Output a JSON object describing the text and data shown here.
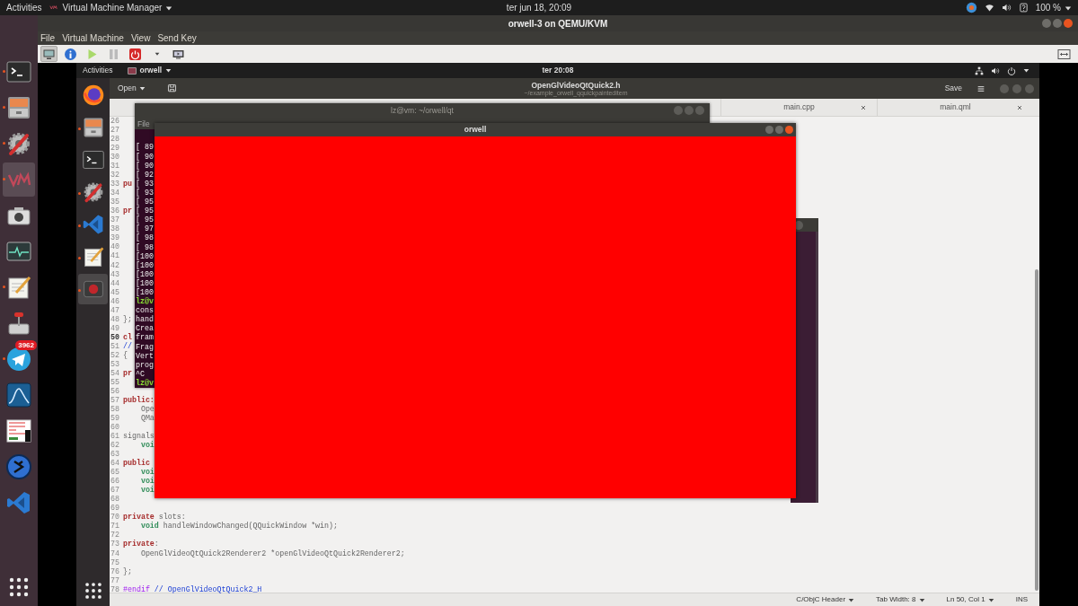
{
  "top_bar": {
    "activities": "Activities",
    "app_menu": "Virtual Machine Manager",
    "clock": "ter jun 18, 20:09",
    "battery": "100 %"
  },
  "dock": {
    "items": [
      {
        "kind": "terminal",
        "running": true,
        "selected": false
      },
      {
        "kind": "files",
        "running": true,
        "selected": false
      },
      {
        "kind": "settings",
        "running": true,
        "selected": false
      },
      {
        "kind": "vm",
        "running": true,
        "selected": true
      },
      {
        "kind": "camera",
        "running": false,
        "selected": false
      },
      {
        "kind": "monitor",
        "running": false,
        "selected": false
      },
      {
        "kind": "notepad",
        "running": true,
        "selected": false
      },
      {
        "kind": "installer",
        "running": false,
        "selected": false
      },
      {
        "kind": "telegram",
        "running": true,
        "selected": false,
        "badge": "3962"
      },
      {
        "kind": "wireshark",
        "running": false,
        "selected": false
      },
      {
        "kind": "bitmap",
        "running": false,
        "selected": false
      },
      {
        "kind": "emblem",
        "running": false,
        "selected": false
      },
      {
        "kind": "vscode",
        "running": false,
        "selected": false
      }
    ]
  },
  "vm_window": {
    "title": "orwell-3 on QEMU/KVM",
    "menu": [
      "File",
      "Virtual Machine",
      "View",
      "Send Key"
    ],
    "toolbar": [
      {
        "kind": "console",
        "pressed": true
      },
      {
        "kind": "info",
        "pressed": false
      },
      {
        "kind": "play",
        "pressed": false
      },
      {
        "kind": "pause",
        "pressed": false
      },
      {
        "kind": "power",
        "pressed": false
      },
      {
        "kind": "caret",
        "pressed": false
      },
      {
        "kind": "screen",
        "pressed": false
      }
    ]
  },
  "guest": {
    "top_bar": {
      "activities": "Activities",
      "app_menu": "orwell",
      "clock": "ter 20:08"
    },
    "dock": {
      "items": [
        {
          "kind": "firefox",
          "running": false,
          "selected": false
        },
        {
          "kind": "files",
          "running": true,
          "selected": false
        },
        {
          "kind": "terminal",
          "running": false,
          "selected": false
        },
        {
          "kind": "settings",
          "running": true,
          "selected": false
        },
        {
          "kind": "vscode",
          "running": true,
          "selected": false
        },
        {
          "kind": "notepad",
          "running": true,
          "selected": false
        },
        {
          "kind": "record",
          "running": true,
          "selected": true
        }
      ]
    },
    "editor": {
      "open_button": "Open",
      "title": "OpenGlVideoQtQuick2.h",
      "subtitle": "~/example_orwell_qquickpainteditem",
      "save_button": "Save",
      "tabs": [
        {
          "label": "main.cpp",
          "selected": false
        },
        {
          "label": "main.qml",
          "selected": false
        }
      ],
      "lines": [
        {
          "number": "26",
          "current": false
        },
        {
          "number": "27",
          "current": false
        },
        {
          "number": "28",
          "current": false
        },
        {
          "number": "29",
          "current": false
        },
        {
          "number": "30",
          "current": false
        },
        {
          "number": "31",
          "current": false
        },
        {
          "number": "32",
          "current": false
        },
        {
          "number": "33",
          "current": false,
          "tokens": [
            {
              "text": "pu",
              "kind": "keyword"
            }
          ]
        },
        {
          "number": "34",
          "current": false
        },
        {
          "number": "35",
          "current": false
        },
        {
          "number": "36",
          "current": false,
          "tokens": [
            {
              "text": "pr",
              "kind": "keyword"
            }
          ]
        },
        {
          "number": "37",
          "current": false
        },
        {
          "number": "38",
          "current": false
        },
        {
          "number": "39",
          "current": false
        },
        {
          "number": "40",
          "current": false
        },
        {
          "number": "41",
          "current": false
        },
        {
          "number": "42",
          "current": false
        },
        {
          "number": "43",
          "current": false
        },
        {
          "number": "44",
          "current": false
        },
        {
          "number": "45",
          "current": false
        },
        {
          "number": "46",
          "current": false
        },
        {
          "number": "47",
          "current": false
        },
        {
          "number": "48",
          "current": false,
          "tokens": [
            {
              "text": "};",
              "kind": "plain"
            }
          ]
        },
        {
          "number": "49",
          "current": false
        },
        {
          "number": "50",
          "current": true,
          "tokens": [
            {
              "text": "cl",
              "kind": "keyword"
            }
          ]
        },
        {
          "number": "51",
          "current": false,
          "tokens": [
            {
              "text": "//",
              "kind": "comment"
            }
          ]
        },
        {
          "number": "52",
          "current": false,
          "tokens": [
            {
              "text": "{",
              "kind": "plain"
            }
          ]
        },
        {
          "number": "53",
          "current": false
        },
        {
          "number": "54",
          "current": false,
          "tokens": [
            {
              "text": "pr",
              "kind": "keyword"
            }
          ]
        },
        {
          "number": "55",
          "current": false
        },
        {
          "number": "56",
          "current": false
        },
        {
          "number": "57",
          "current": false,
          "tokens": [
            {
              "text": "public:",
              "kind": "keyword"
            }
          ]
        },
        {
          "number": "58",
          "current": false,
          "tokens": [
            {
              "text": "    Ope",
              "kind": "plain"
            }
          ]
        },
        {
          "number": "59",
          "current": false,
          "tokens": [
            {
              "text": "    QMa",
              "kind": "plain"
            }
          ]
        },
        {
          "number": "60",
          "current": false
        },
        {
          "number": "61",
          "current": false,
          "tokens": [
            {
              "text": "signals",
              "kind": "plain"
            }
          ]
        },
        {
          "number": "62",
          "current": false,
          "tokens": [
            {
              "text": "    voi",
              "kind": "type"
            }
          ]
        },
        {
          "number": "63",
          "current": false
        },
        {
          "number": "64",
          "current": false,
          "tokens": [
            {
              "text": "public",
              "kind": "keyword"
            }
          ]
        },
        {
          "number": "65",
          "current": false,
          "tokens": [
            {
              "text": "    voi",
              "kind": "type"
            }
          ]
        },
        {
          "number": "66",
          "current": false,
          "tokens": [
            {
              "text": "    voi",
              "kind": "type"
            }
          ]
        },
        {
          "number": "67",
          "current": false,
          "tokens": [
            {
              "text": "    voi",
              "kind": "type"
            }
          ]
        },
        {
          "number": "68",
          "current": false
        },
        {
          "number": "69",
          "current": false
        },
        {
          "number": "70",
          "current": false,
          "tokens": [
            {
              "text": "private",
              "kind": "keyword"
            },
            {
              "text": " slots:",
              "kind": "plain"
            }
          ]
        },
        {
          "number": "71",
          "current": false,
          "tokens": [
            {
              "text": "    void",
              "kind": "type"
            },
            {
              "text": " handleWindowChanged(QQuickWindow *win);",
              "kind": "plain"
            }
          ]
        },
        {
          "number": "72",
          "current": false
        },
        {
          "number": "73",
          "current": false,
          "tokens": [
            {
              "text": "private",
              "kind": "keyword"
            },
            {
              "text": ":",
              "kind": "plain"
            }
          ]
        },
        {
          "number": "74",
          "current": false,
          "tokens": [
            {
              "text": "    OpenGlVideoQtQuick2Renderer2 *openGlVideoQtQuick2Renderer2;",
              "kind": "plain"
            }
          ]
        },
        {
          "number": "75",
          "current": false
        },
        {
          "number": "76",
          "current": false,
          "tokens": [
            {
              "text": "};",
              "kind": "plain"
            }
          ]
        },
        {
          "number": "77",
          "current": false
        },
        {
          "number": "78",
          "current": false,
          "tokens": [
            {
              "text": "#endif",
              "kind": "preproc"
            },
            {
              "text": " // OpenGlVideoQtQuick2_H",
              "kind": "comment"
            }
          ]
        }
      ],
      "status_bar": {
        "language": "C/ObjC Header",
        "tab_width": "Tab Width: 8",
        "position": "Ln 50, Col 1",
        "mode": "INS"
      }
    },
    "terminal": {
      "title": "lz@vm: ~/orwell/qt",
      "menu": "File",
      "lines": [
        {
          "text": "[ 89",
          "kind": "output"
        },
        {
          "text": "[ 90",
          "kind": "output"
        },
        {
          "text": "[ 90",
          "kind": "output"
        },
        {
          "text": "[ 92",
          "kind": "output"
        },
        {
          "text": "[ 93",
          "kind": "output"
        },
        {
          "text": "[ 93",
          "kind": "output"
        },
        {
          "text": "[ 95",
          "kind": "output"
        },
        {
          "text": "[ 95",
          "kind": "output"
        },
        {
          "text": "[ 95",
          "kind": "output"
        },
        {
          "text": "[ 97",
          "kind": "output"
        },
        {
          "text": "[ 98",
          "kind": "output"
        },
        {
          "text": "[ 98",
          "kind": "output"
        },
        {
          "text": "[100",
          "kind": "output"
        },
        {
          "text": "[100",
          "kind": "output"
        },
        {
          "text": "[100",
          "kind": "output"
        },
        {
          "text": "[100",
          "kind": "output"
        },
        {
          "text": "[100",
          "kind": "output"
        },
        {
          "text": "lz@v",
          "kind": "prompt"
        },
        {
          "text": "cons",
          "kind": "output"
        },
        {
          "text": "hand",
          "kind": "output"
        },
        {
          "text": "Crea",
          "kind": "output"
        },
        {
          "text": "fram",
          "kind": "output"
        },
        {
          "text": "Frag",
          "kind": "output"
        },
        {
          "text": "Vert",
          "kind": "output"
        },
        {
          "text": "prog",
          "kind": "output"
        },
        {
          "text": "^C",
          "kind": "output"
        },
        {
          "text": "lz@v",
          "kind": "prompt"
        }
      ]
    },
    "app_window": {
      "title": "orwell"
    }
  }
}
